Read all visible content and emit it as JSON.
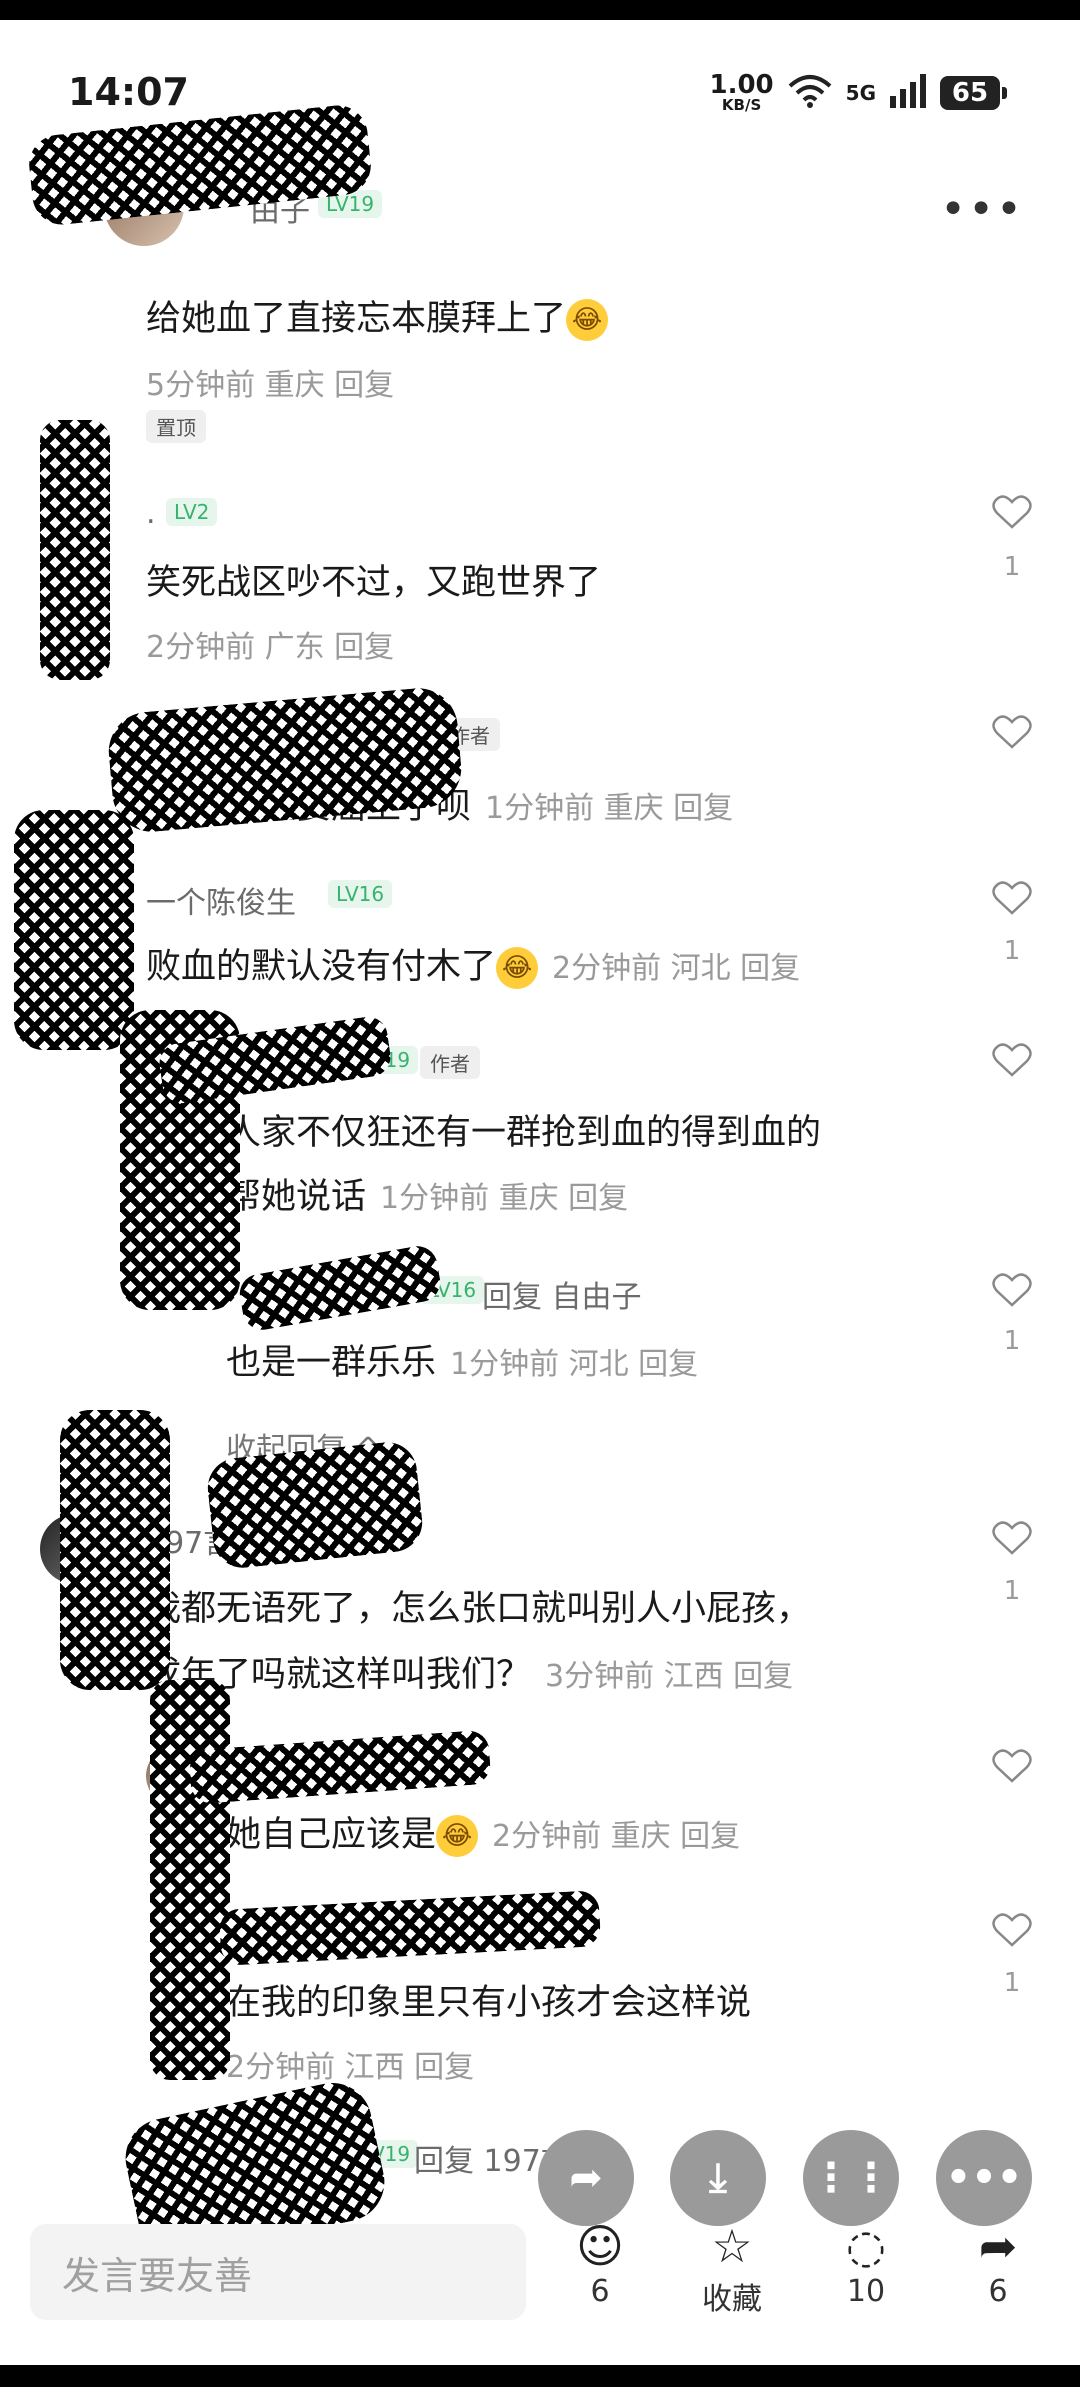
{
  "status": {
    "time": "14:07",
    "netspeed": "1.00",
    "netunit": "KB/S",
    "signal": "5G",
    "battery": "65"
  },
  "header": {
    "back": "‹",
    "more": "•••"
  },
  "comments": [
    {
      "name": "由子",
      "level": "LV19",
      "text": "给她血了直接忘本膜拜上了",
      "meta": "5分钟前 重庆 回复",
      "tag": "置顶"
    },
    {
      "name": ".",
      "level": "LV2",
      "text": "笑死战区吵不过，又跑世界了",
      "meta": "2分钟前 广东 回复",
      "likes": "1"
    },
    {
      "tag": "作者",
      "text": "现在委屈上了呗",
      "meta": "1分钟前 重庆 回复"
    },
    {
      "name": "一个陈俊生",
      "level": "LV16",
      "text": "败血的默认没有付木了",
      "meta": "2分钟前 河北 回复",
      "likes": "1"
    },
    {
      "level": "LV19",
      "tag": "作者",
      "text1": "人家不仅狂还有一群抢到血的得到血的",
      "text2": "帮她说话",
      "meta": "1分钟前 重庆 回复"
    },
    {
      "level": "LV16",
      "reply": "回复 自由子",
      "text": "也是一群乐乐",
      "meta": "1分钟前 河北 回复",
      "likes": "1"
    },
    {
      "name": "197言浔",
      "text1": "我都无语死了，怎么张口就叫别人小屁孩，",
      "text2": "成年了吗就这样叫我们？",
      "meta": "3分钟前 江西 回复",
      "likes": "1"
    },
    {
      "text": "她自己应该是",
      "meta": "2分钟前 重庆 回复"
    },
    {
      "text": "在我的印象里只有小孩才会这样说",
      "meta": "2分钟前 江西 回复",
      "likes": "1"
    },
    {
      "level": "LV19",
      "reply": "回复 197言浔"
    }
  ],
  "collapse": "收起回复 ^",
  "bottom": {
    "input_placeholder": "发言要友善",
    "like_count": "6",
    "fav_label": "收藏",
    "comment_count": "10",
    "share_count": "6"
  }
}
